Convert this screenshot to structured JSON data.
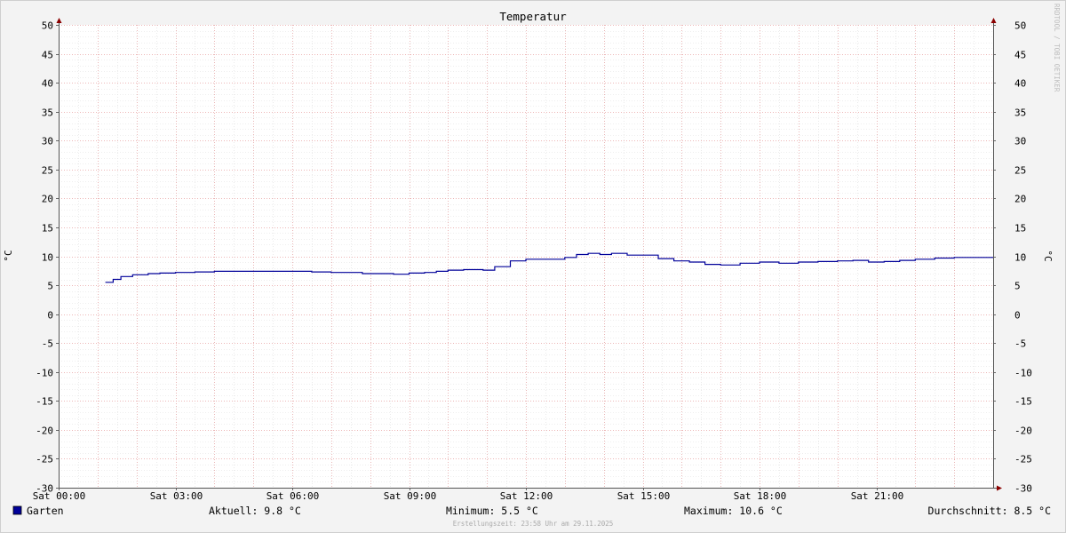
{
  "chart_data": {
    "type": "line",
    "title": "Temperatur",
    "ylabel": "°C",
    "xlabel": "",
    "ylim": [
      -30,
      50
    ],
    "y_ticks": [
      -30,
      -25,
      -20,
      -15,
      -10,
      -5,
      0,
      5,
      10,
      15,
      20,
      25,
      30,
      35,
      40,
      45,
      50
    ],
    "x_range_hours": [
      0,
      24
    ],
    "x_ticks": [
      {
        "hour": 0,
        "label": "Sat 00:00"
      },
      {
        "hour": 3,
        "label": "Sat 03:00"
      },
      {
        "hour": 6,
        "label": "Sat 06:00"
      },
      {
        "hour": 9,
        "label": "Sat 09:00"
      },
      {
        "hour": 12,
        "label": "Sat 12:00"
      },
      {
        "hour": 15,
        "label": "Sat 15:00"
      },
      {
        "hour": 18,
        "label": "Sat 18:00"
      },
      {
        "hour": 21,
        "label": "Sat 21:00"
      }
    ],
    "grid": true,
    "series": [
      {
        "name": "Garten",
        "color": "#000099",
        "x": [
          1.2,
          1.4,
          1.6,
          1.9,
          2.3,
          2.6,
          3.0,
          3.5,
          4.0,
          5.0,
          6.0,
          6.5,
          7.0,
          7.8,
          8.2,
          8.6,
          9.0,
          9.4,
          9.7,
          10.0,
          10.4,
          10.9,
          11.2,
          11.6,
          12.0,
          12.5,
          13.0,
          13.3,
          13.6,
          13.9,
          14.2,
          14.6,
          15.0,
          15.4,
          15.8,
          16.2,
          16.6,
          17.0,
          17.5,
          18.0,
          18.5,
          19.0,
          19.5,
          20.0,
          20.4,
          20.8,
          21.2,
          21.6,
          22.0,
          22.5,
          23.0,
          23.5,
          24.0
        ],
        "y": [
          5.5,
          6.0,
          6.5,
          6.8,
          7.0,
          7.1,
          7.2,
          7.3,
          7.4,
          7.4,
          7.4,
          7.3,
          7.2,
          7.0,
          7.0,
          6.9,
          7.1,
          7.2,
          7.4,
          7.6,
          7.7,
          7.6,
          8.2,
          9.2,
          9.5,
          9.5,
          9.8,
          10.3,
          10.5,
          10.3,
          10.5,
          10.2,
          10.2,
          9.6,
          9.2,
          9.0,
          8.6,
          8.5,
          8.8,
          9.0,
          8.8,
          9.0,
          9.1,
          9.2,
          9.3,
          9.0,
          9.1,
          9.3,
          9.5,
          9.7,
          9.8,
          9.8,
          9.8
        ]
      }
    ]
  },
  "legend": {
    "series_name": "Garten",
    "current": "Aktuell: 9.8 °C",
    "minimum": "Minimum: 5.5 °C",
    "maximum": "Maximum: 10.6 °C",
    "average": "Durchschnitt: 8.5 °C",
    "created": "Erstellungszeit: 23:58 Uhr am 29.11.2025"
  },
  "watermark": "RRDTOOL / TOBI OETIKER"
}
